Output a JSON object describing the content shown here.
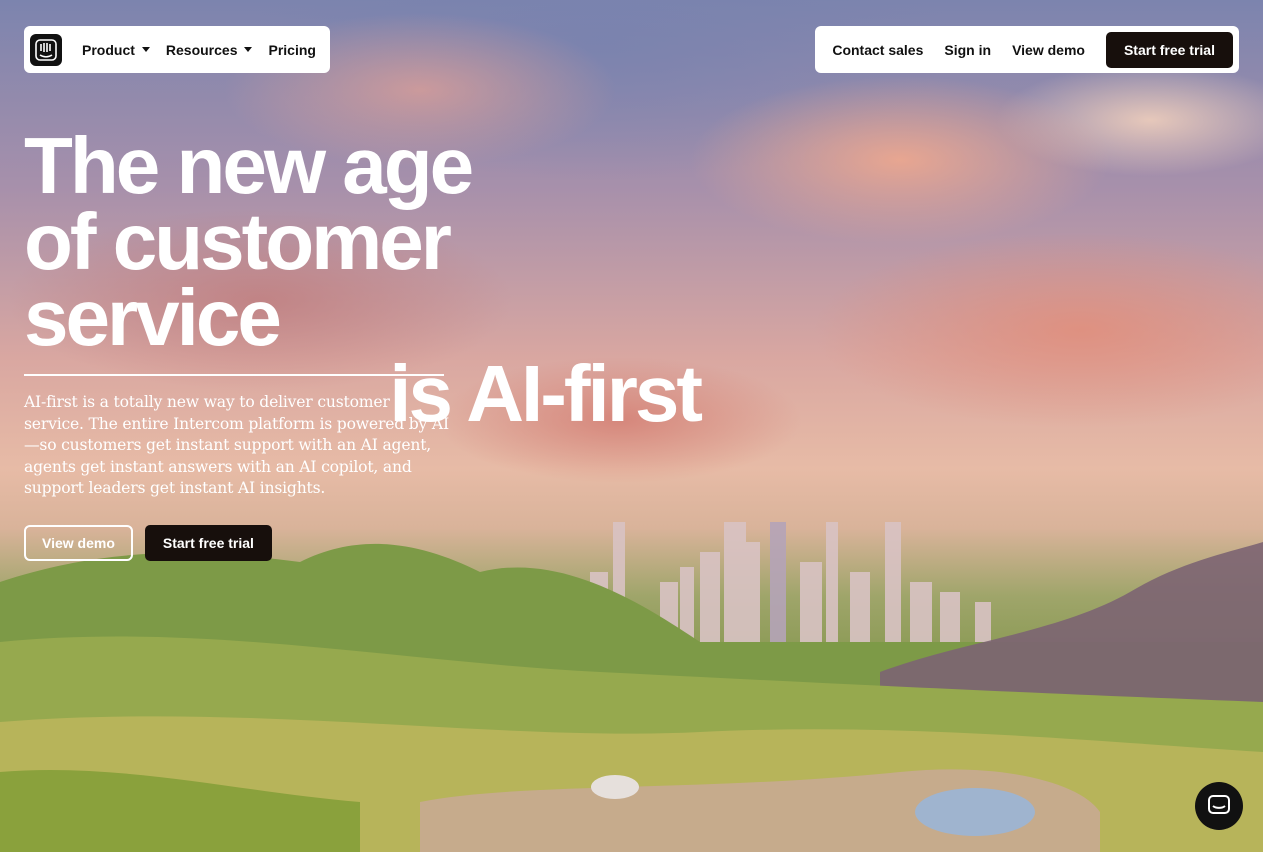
{
  "nav": {
    "logo_icon": "intercom-logo-icon",
    "left_items": [
      {
        "label": "Product",
        "has_dropdown": true
      },
      {
        "label": "Resources",
        "has_dropdown": true
      },
      {
        "label": "Pricing",
        "has_dropdown": false
      }
    ],
    "contact_sales": "Contact sales",
    "sign_in": "Sign in",
    "view_demo": "View demo",
    "start_trial": "Start free trial"
  },
  "hero": {
    "headline_line1": "The new age",
    "headline_line2": "of customer service",
    "headline_line3": "is AI-first",
    "description": "AI-first is a totally new way to deliver customer service. The entire Intercom platform is powered by AI—so customers get instant support with an AI agent, agents get instant answers with an AI copilot, and support leaders get instant AI insights.",
    "cta_view_demo": "View demo",
    "cta_start_trial": "Start free trial"
  },
  "chat_launcher": {
    "icon": "chat-bubble-icon"
  },
  "colors": {
    "dark_button": "#170f0c",
    "white": "#ffffff"
  }
}
